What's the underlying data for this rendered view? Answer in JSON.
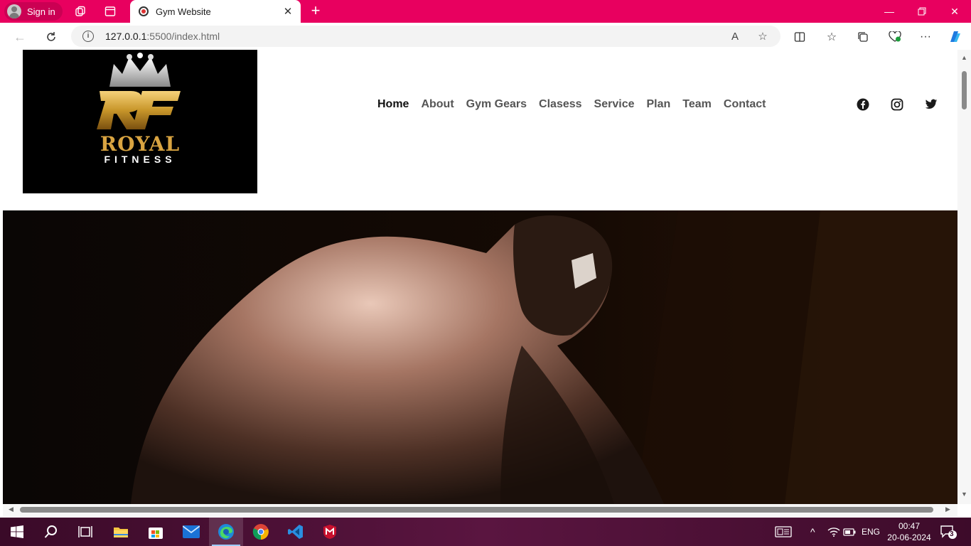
{
  "browser": {
    "profile_label": "Sign in",
    "tab_title": "Gym Website",
    "url_host": "127.0.0.1",
    "url_path": ":5500/index.html"
  },
  "site": {
    "logo": {
      "top_text": "ROYAL",
      "bottom_text": "FITNESS",
      "monogram": "RF"
    },
    "nav": [
      {
        "label": "Home",
        "active": true
      },
      {
        "label": "About"
      },
      {
        "label": "Gym Gears"
      },
      {
        "label": "Clasess"
      },
      {
        "label": "Service"
      },
      {
        "label": "Plan"
      },
      {
        "label": "Team"
      },
      {
        "label": "Contact"
      }
    ],
    "socials": [
      "facebook-icon",
      "instagram-icon",
      "twitter-icon"
    ]
  },
  "taskbar": {
    "language": "ENG",
    "time": "00:47",
    "date": "20-06-2024",
    "notification_count": "3"
  },
  "colors": {
    "tabbar": "#e8005f",
    "taskbar": "#4a1035",
    "logo_gold": "#c8962a"
  }
}
